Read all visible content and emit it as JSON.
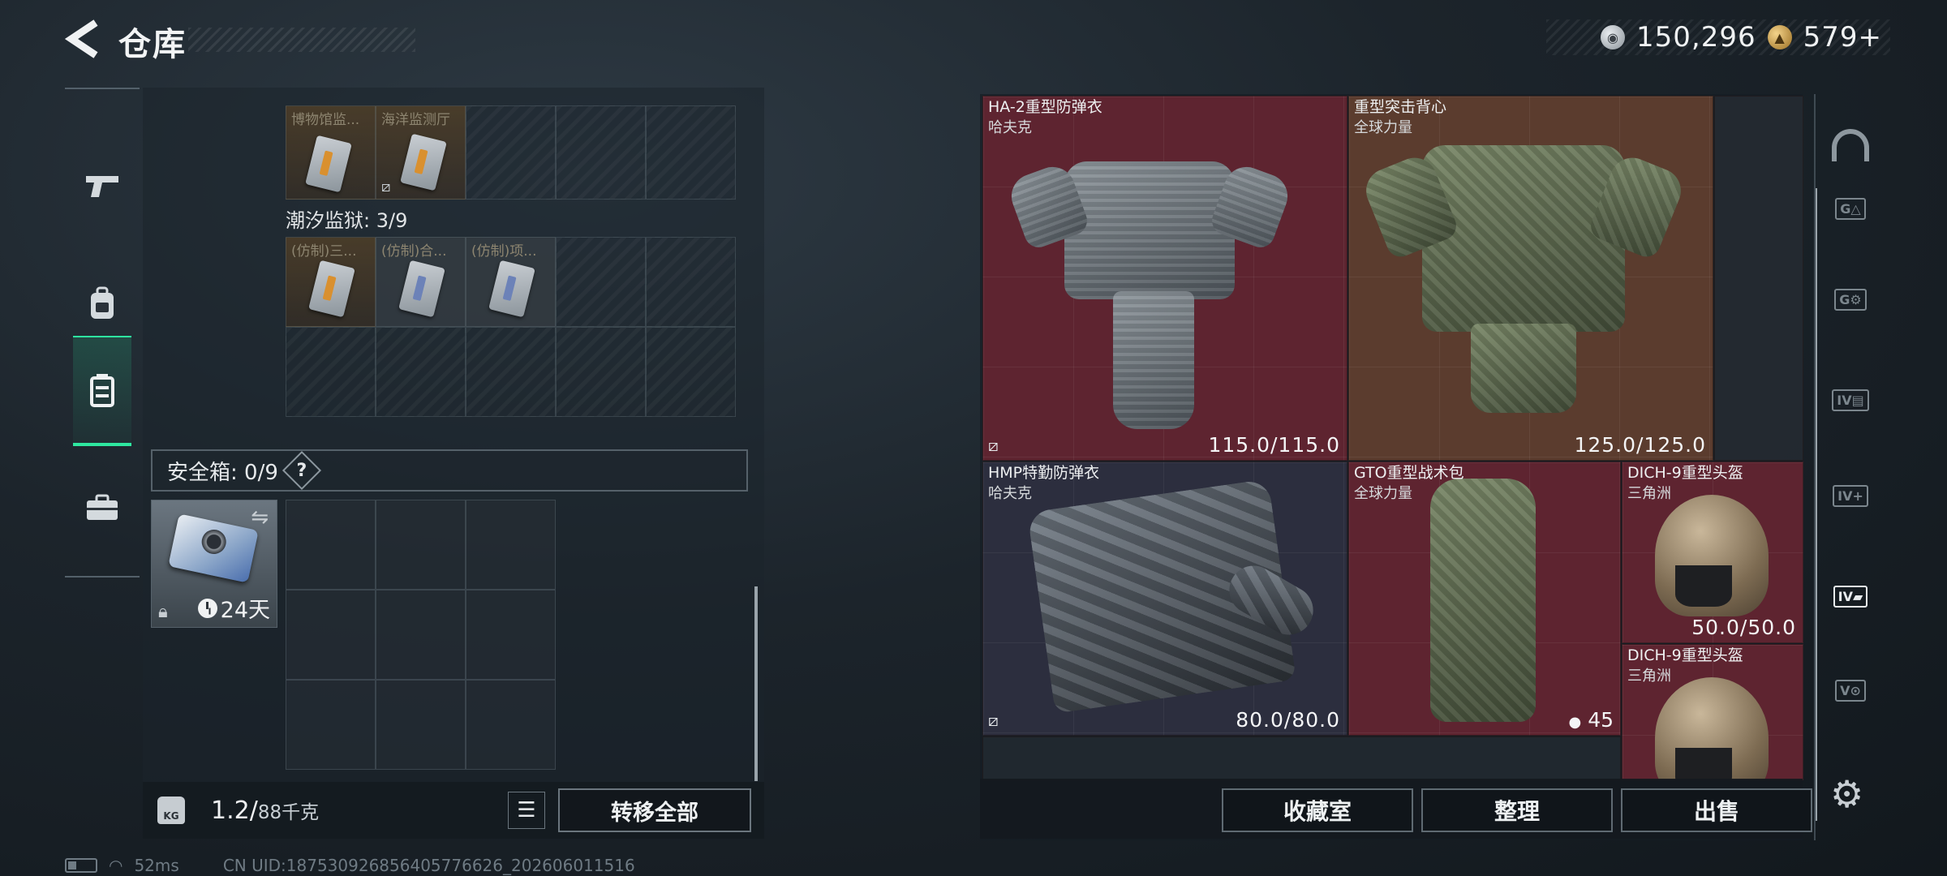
{
  "header": {
    "title": "仓库",
    "currency": [
      {
        "icon": "silver-coin-icon",
        "value": "150,296"
      },
      {
        "icon": "gold-coin-icon",
        "value": "579+"
      }
    ]
  },
  "left_nav": [
    {
      "icon": "pistol-icon",
      "glyph": "⌐"
    },
    {
      "icon": "backpack-icon",
      "glyph": "◈"
    },
    {
      "icon": "storage-case-icon",
      "glyph": "▤",
      "active": true
    },
    {
      "icon": "toolbox-icon",
      "glyph": "▬"
    }
  ],
  "collections": [
    {
      "items": [
        "博物馆监...",
        "海洋监测厅"
      ]
    },
    {
      "title": "潮汐监狱: 3/9",
      "items": [
        "(仿制)三...",
        "(仿制)合...",
        "(仿制)项..."
      ]
    }
  ],
  "safe_box": {
    "label": "安全箱: 0/9",
    "help": "?",
    "timer": "24天"
  },
  "weight": {
    "value": "1.2/",
    "unit": "88千克",
    "icon_text": "KG"
  },
  "buttons": {
    "transfer_all": "转移全部",
    "collection_room": "收藏室",
    "organize": "整理",
    "sell": "出售"
  },
  "items": [
    {
      "name": "HA-2重型防弹衣",
      "maker": "哈夫克",
      "durability": "115.0/115.0"
    },
    {
      "name": "重型突击背心",
      "maker": "全球力量",
      "durability": "125.0/125.0"
    },
    {
      "name": "HMP特勤防弹衣",
      "maker": "哈夫克",
      "durability": "80.0/80.0"
    },
    {
      "name": "GTO重型战术包",
      "maker": "全球力量",
      "count": "45"
    },
    {
      "name": "DICH-9重型头盔",
      "maker": "三角洲",
      "durability": "50.0/50.0"
    },
    {
      "name": "DICH-9重型头盔",
      "maker": "三角洲"
    }
  ],
  "status": {
    "ping": "52ms",
    "uid": "CN UID:187530926856405776626_202606011516"
  },
  "colors": {
    "accent": "#2ee8a0",
    "rare_red": "#5e2430",
    "rare_brown": "#5b3c2e"
  }
}
